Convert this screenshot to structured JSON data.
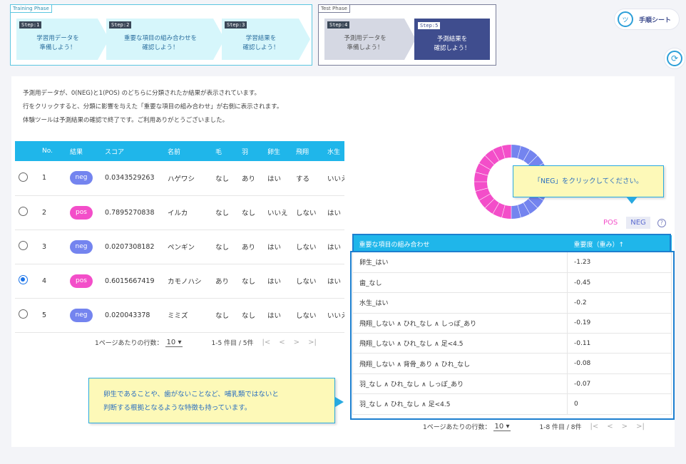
{
  "phases": {
    "training_label": "Training Phase",
    "test_label": "Test Phase",
    "steps": [
      {
        "tag": "Step:1",
        "line1": "学習用データを",
        "line2": "準備しよう！"
      },
      {
        "tag": "Step:2",
        "line1": "重要な項目の組み合わせを",
        "line2": "確認しよう！"
      },
      {
        "tag": "Step:3",
        "line1": "学習結果を",
        "line2": "確認しよう！"
      },
      {
        "tag": "Step:4",
        "line1": "予測用データを",
        "line2": "準備しよう！"
      },
      {
        "tag": "Step:5",
        "line1": "予測結果を",
        "line2": "確認しよう！"
      }
    ]
  },
  "side": {
    "manual_label": "手順シート",
    "manual_icon": "face-icon",
    "refresh_icon": "refresh-icon"
  },
  "description": [
    "予測用データが、0(NEG)と1(POS) のどちらに分類されたか結果が表示されています。",
    "行をクリックすると、分類に影響を与えた「重要な項目の組み合わせ」が右側に表示されます。",
    "体験ツールは予測結果の確認で終了です。ご利用ありがとうございました。"
  ],
  "left_table": {
    "headers": [
      "No.",
      "結果",
      "スコア",
      "名前",
      "毛",
      "羽",
      "卵生",
      "飛翔",
      "水生"
    ],
    "rows": [
      {
        "no": "1",
        "result": "neg",
        "score": "0.0343529263",
        "name": "ハゲワシ",
        "hair": "なし",
        "wing": "あり",
        "egg": "はい",
        "fly": "する",
        "water": "いいえ",
        "selected": false
      },
      {
        "no": "2",
        "result": "pos",
        "score": "0.7895270838",
        "name": "イルカ",
        "hair": "なし",
        "wing": "なし",
        "egg": "いいえ",
        "fly": "しない",
        "water": "はい",
        "selected": false
      },
      {
        "no": "3",
        "result": "neg",
        "score": "0.0207308182",
        "name": "ペンギン",
        "hair": "なし",
        "wing": "あり",
        "egg": "はい",
        "fly": "しない",
        "water": "はい",
        "selected": false
      },
      {
        "no": "4",
        "result": "pos",
        "score": "0.6015667419",
        "name": "カモノハシ",
        "hair": "あり",
        "wing": "なし",
        "egg": "はい",
        "fly": "しない",
        "water": "はい",
        "selected": true
      },
      {
        "no": "5",
        "result": "neg",
        "score": "0.020043378",
        "name": "ミミズ",
        "hair": "なし",
        "wing": "なし",
        "egg": "はい",
        "fly": "しない",
        "water": "いいえ",
        "selected": false
      }
    ],
    "pager": {
      "rows_label": "1ページあたりの行数：",
      "rows_value": "10",
      "range": "1-5 件目 / 5件"
    }
  },
  "chart": {
    "legend_pos": "POS",
    "legend_neg": "NEG",
    "help_icon": "help-icon",
    "colors": {
      "pos": "#f34ec9",
      "neg": "#7484ef"
    },
    "pos_fraction": 0.5
  },
  "tooltip_neg": "「NEG」をクリックしてください。",
  "right_table": {
    "headers": [
      "重要な項目の組み合わせ",
      "重要度（重み）↑"
    ],
    "rows": [
      {
        "combo": "卵生_はい",
        "weight": "-1.23"
      },
      {
        "combo": "歯_なし",
        "weight": "-0.45"
      },
      {
        "combo": "水生_はい",
        "weight": "-0.2"
      },
      {
        "combo": "飛翔_しない ∧ ひれ_なし ∧ しっぽ_あり",
        "weight": "-0.19"
      },
      {
        "combo": "飛翔_しない ∧ ひれ_なし ∧ 足<4.5",
        "weight": "-0.11"
      },
      {
        "combo": "飛翔_しない ∧ 背骨_あり ∧ ひれ_なし",
        "weight": "-0.08"
      },
      {
        "combo": "羽_なし ∧ ひれ_なし ∧ しっぽ_あり",
        "weight": "-0.07"
      },
      {
        "combo": "羽_なし ∧ ひれ_なし ∧ 足<4.5",
        "weight": "0"
      }
    ],
    "pager": {
      "rows_label": "1ページあたりの行数：",
      "rows_value": "10",
      "range": "1-8 件目 / 8件"
    }
  },
  "callout_bottom": {
    "line1": "卵生であることや、歯がないことなど、哺乳類ではないと",
    "line2": "判断する根拠となるような特徴も持っています。"
  }
}
